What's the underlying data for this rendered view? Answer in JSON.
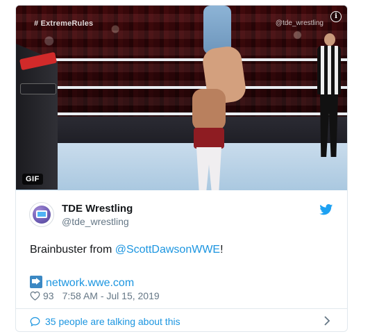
{
  "media": {
    "hashtag": "# ExtremeRules",
    "watermark": "@tde_wrestling",
    "info_symbol": "i",
    "gif_badge": "GIF",
    "info_icon": "info-icon"
  },
  "tweet": {
    "author_name": "TDE Wrestling",
    "author_handle": "@tde_wrestling",
    "text_prefix": "Brainbuster from ",
    "mention": "@ScottDawsonWWE",
    "text_suffix": "!",
    "link_text": "network.wwe.com",
    "like_count": "93",
    "timestamp": "7:58 AM - Jul 15, 2019",
    "talking_text": "35 people are talking about this",
    "icons": [
      "twitter-bird-icon",
      "heart-icon",
      "speech-bubble-icon",
      "right-arrow-icon",
      "chevron-right-icon"
    ]
  },
  "colors": {
    "link": "#1b95e0",
    "secondary_text": "#657786",
    "border": "#e1e8ed",
    "twitter_blue": "#1da1f2"
  }
}
